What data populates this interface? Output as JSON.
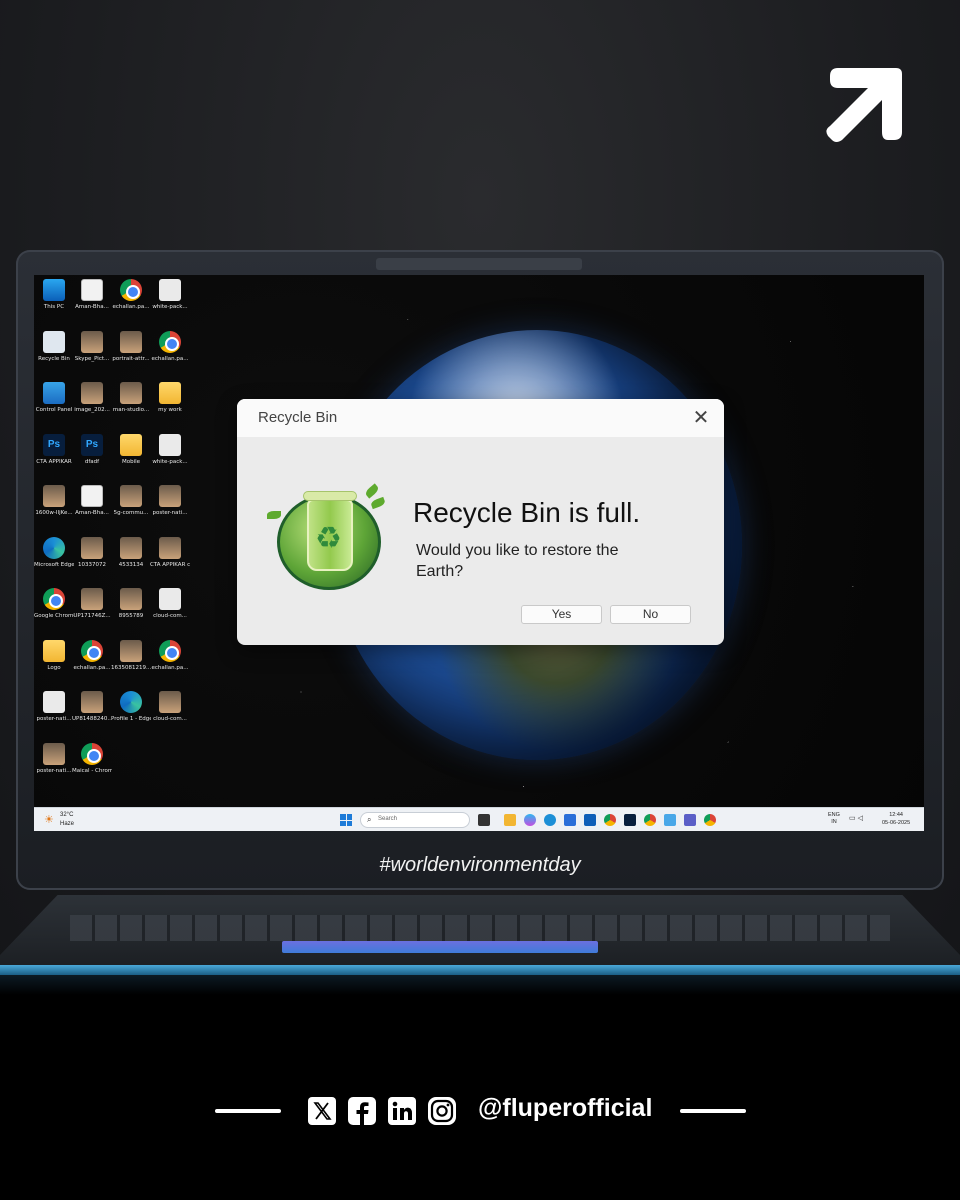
{
  "brand": {
    "icon": "arrow-up-right-icon"
  },
  "desktop": {
    "icons": [
      {
        "label": "This PC",
        "icon": "this-pc-icon"
      },
      {
        "label": "Aman-Bha...",
        "icon": "document-icon"
      },
      {
        "label": "echallan.pa...",
        "icon": "chrome-icon"
      },
      {
        "label": "white-pack...",
        "icon": "file-icon"
      },
      {
        "label": "Recycle Bin",
        "icon": "recycle-bin-icon"
      },
      {
        "label": "Skype_Pict...",
        "icon": "image-icon"
      },
      {
        "label": "portrait-attr...",
        "icon": "image-icon"
      },
      {
        "label": "echallan.pa...",
        "icon": "chrome-icon"
      },
      {
        "label": "Control Panel",
        "icon": "control-panel-icon"
      },
      {
        "label": "image_202...",
        "icon": "image-icon"
      },
      {
        "label": "man-studio...",
        "icon": "image-icon"
      },
      {
        "label": "my work",
        "icon": "folder-icon"
      },
      {
        "label": "CTA APPIKAR",
        "icon": "photoshop-icon"
      },
      {
        "label": "dfadf",
        "icon": "photoshop-icon"
      },
      {
        "label": "Mobile",
        "icon": "folder-icon"
      },
      {
        "label": "white-pack...",
        "icon": "file-icon"
      },
      {
        "label": "1600w-IIjKe...",
        "icon": "image-icon"
      },
      {
        "label": "Aman-Bha...",
        "icon": "document-icon"
      },
      {
        "label": "5g-commu...",
        "icon": "image-icon"
      },
      {
        "label": "poster-nati...",
        "icon": "image-icon"
      },
      {
        "label": "Microsoft Edge",
        "icon": "edge-icon"
      },
      {
        "label": "10337072",
        "icon": "image-icon"
      },
      {
        "label": "4533134",
        "icon": "image-icon"
      },
      {
        "label": "CTA APPIKAR copy",
        "icon": "image-icon"
      },
      {
        "label": "Google Chrome",
        "icon": "chrome-icon"
      },
      {
        "label": "UP171746Z...",
        "icon": "image-icon"
      },
      {
        "label": "8955789",
        "icon": "image-icon"
      },
      {
        "label": "cloud-com...",
        "icon": "file-icon"
      },
      {
        "label": "Logo",
        "icon": "folder-icon"
      },
      {
        "label": "echallan.pa...",
        "icon": "chrome-icon"
      },
      {
        "label": "1635081219...",
        "icon": "image-icon"
      },
      {
        "label": "echallan.pa...",
        "icon": "chrome-icon"
      },
      {
        "label": "poster-nati...",
        "icon": "file-icon"
      },
      {
        "label": "UP81488240...",
        "icon": "image-icon"
      },
      {
        "label": "Profile 1 - Edge",
        "icon": "edge-icon"
      },
      {
        "label": "cloud-com...",
        "icon": "image-icon"
      },
      {
        "label": "poster-nati...",
        "icon": "image-icon"
      },
      {
        "label": "Maical - Chrome",
        "icon": "chrome-icon"
      }
    ]
  },
  "taskbar": {
    "weather_temp": "32°C",
    "weather_condition": "Haze",
    "search_placeholder": "Search",
    "lang_line1": "ENG",
    "lang_line2": "IN",
    "time": "12:44",
    "date": "05-06-2025"
  },
  "dialog": {
    "title": "Recycle Bin",
    "heading": "Recycle Bin is full.",
    "message": "Would you like to restore the Earth?",
    "yes_label": "Yes",
    "no_label": "No"
  },
  "hashtag": "#worldenvironmentday",
  "footer": {
    "handle": "@fluperofficial",
    "socials": [
      "x-icon",
      "facebook-icon",
      "linkedin-icon",
      "instagram-icon"
    ]
  }
}
